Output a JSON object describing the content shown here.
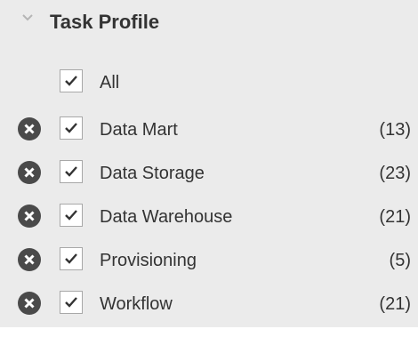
{
  "filter": {
    "title": "Task Profile",
    "expand_icon": "chevron-down-icon",
    "all_label": "All",
    "all_checked": true,
    "items": [
      {
        "label": "Data Mart",
        "count": "(13)",
        "checked": true
      },
      {
        "label": "Data Storage",
        "count": "(23)",
        "checked": true
      },
      {
        "label": "Data Warehouse",
        "count": "(21)",
        "checked": true
      },
      {
        "label": "Provisioning",
        "count": "(5)",
        "checked": true
      },
      {
        "label": "Workflow",
        "count": "(21)",
        "checked": true
      }
    ]
  },
  "colors": {
    "panel_bg": "#ebebeb",
    "text": "#333333",
    "remove_icon_bg": "#4a4a4a",
    "checkbox_border": "#a8a8a8"
  }
}
